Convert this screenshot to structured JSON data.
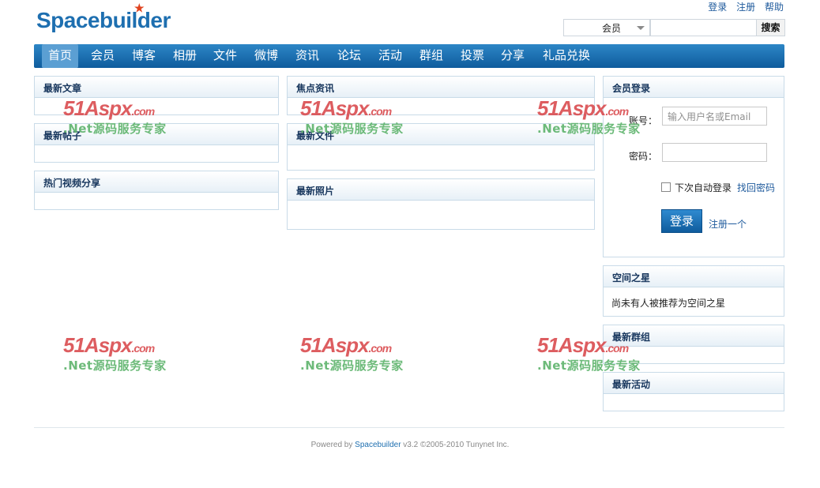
{
  "header": {
    "logo": "Spacebuilder",
    "links": [
      "登录",
      "注册",
      "帮助"
    ],
    "search": {
      "select_value": "会员",
      "button": "搜索"
    }
  },
  "nav": {
    "items": [
      "首页",
      "会员",
      "博客",
      "相册",
      "文件",
      "微博",
      "资讯",
      "论坛",
      "活动",
      "群组",
      "投票",
      "分享",
      "礼品兑换"
    ],
    "active": "首页"
  },
  "panels": {
    "latest_articles": "最新文章",
    "latest_posts": "最新帖子",
    "hot_videos": "热门视频分享",
    "focus_news": "焦点资讯",
    "latest_files": "最新文件",
    "latest_photos": "最新照片",
    "space_star": {
      "title": "空间之星",
      "text": "尚未有人被推荐为空间之星"
    },
    "latest_groups": "最新群组",
    "latest_events": "最新活动"
  },
  "login": {
    "title": "会员登录",
    "account_label": "账号：",
    "account_placeholder": "输入用户名或Email",
    "password_label": "密码：",
    "remember": "下次自动登录",
    "forgot": "找回密码",
    "submit": "登录",
    "register": "注册一个"
  },
  "watermark": {
    "line1": "51Aspx",
    "line1_suffix": ".com",
    "line2": ".Net源码服务专家"
  },
  "footer": {
    "prefix": "Powered by ",
    "brand": "Spacebuilder",
    "suffix": " v3.2 ©2005-2010 Tunynet Inc."
  }
}
